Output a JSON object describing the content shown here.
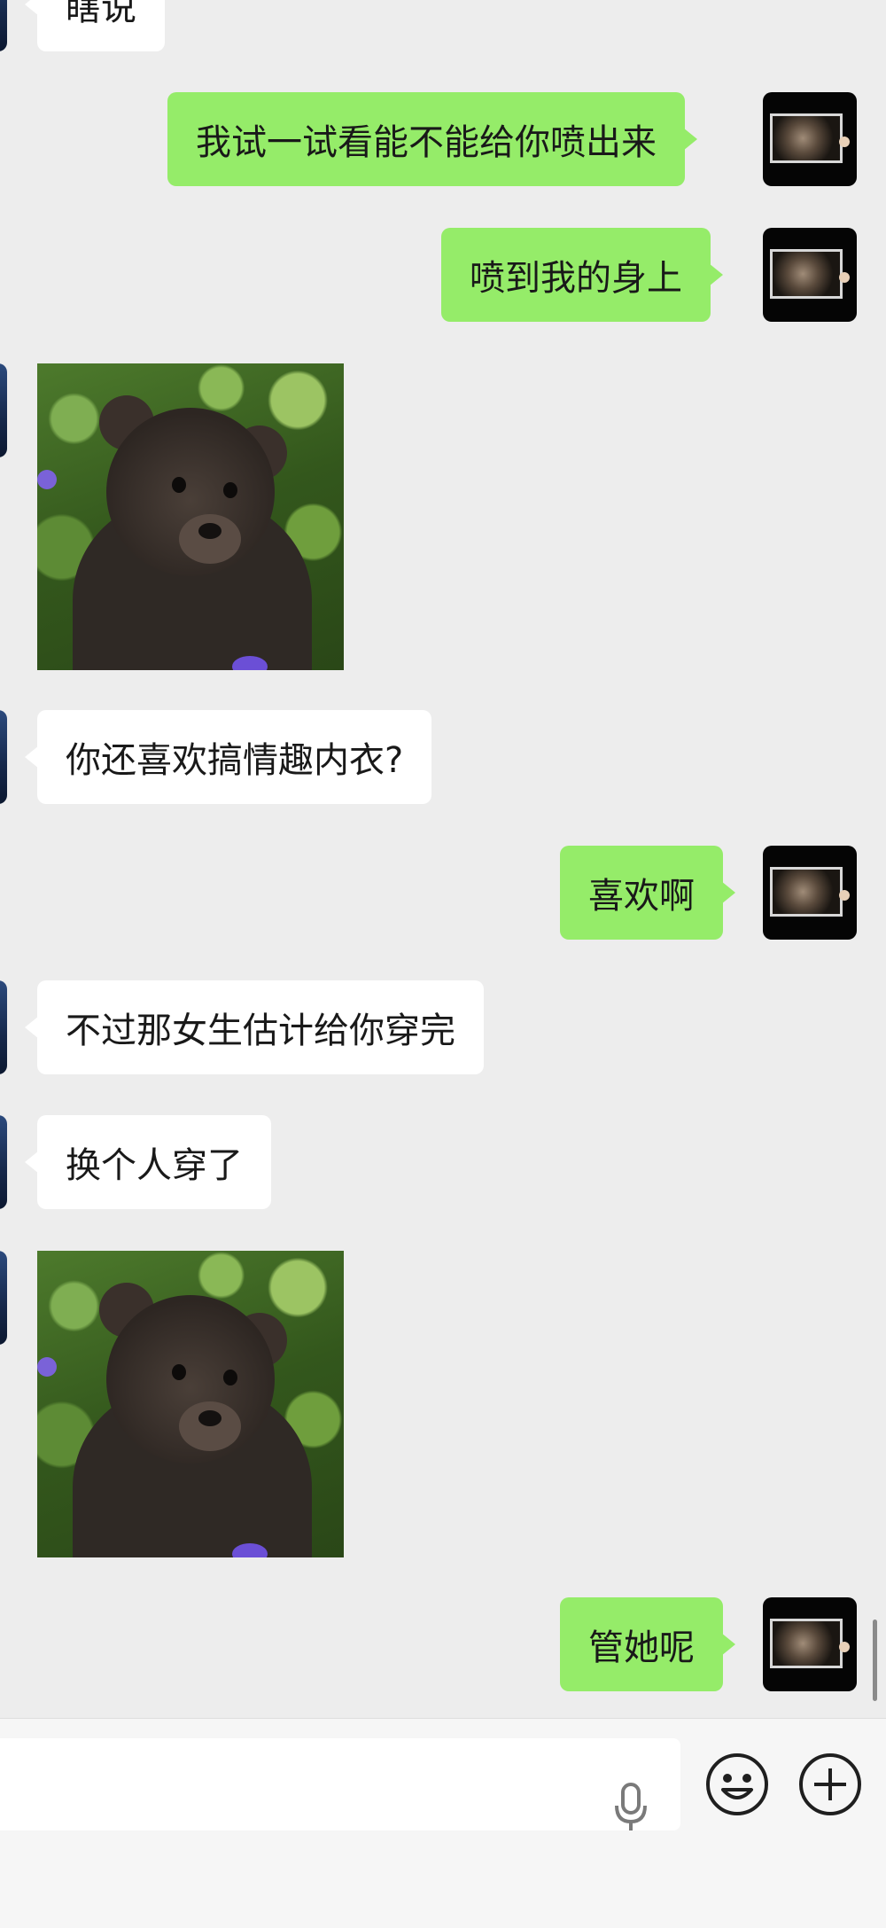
{
  "messages": [
    {
      "side": "left",
      "type": "text",
      "text": "瞎说"
    },
    {
      "side": "right",
      "type": "text",
      "text": "我试一试看能不能给你喷出来"
    },
    {
      "side": "right",
      "type": "text",
      "text": "喷到我的身上"
    },
    {
      "side": "left",
      "type": "sticker",
      "sticker": "brown-bear-cub"
    },
    {
      "side": "left",
      "type": "text",
      "text": "你还喜欢搞情趣内衣?"
    },
    {
      "side": "right",
      "type": "text",
      "text": "喜欢啊"
    },
    {
      "side": "left",
      "type": "text",
      "text": "不过那女生估计给你穿完"
    },
    {
      "side": "left",
      "type": "text",
      "text": "换个人穿了"
    },
    {
      "side": "left",
      "type": "sticker",
      "sticker": "brown-bear-cub"
    },
    {
      "side": "right",
      "type": "text",
      "text": "管她呢"
    }
  ],
  "input_bar": {
    "text_value": "",
    "icons": [
      "microphone-icon",
      "emoji-icon",
      "plus-icon"
    ]
  },
  "colors": {
    "background": "#ededed",
    "outgoing_bubble": "#95ec69",
    "incoming_bubble": "#ffffff"
  }
}
